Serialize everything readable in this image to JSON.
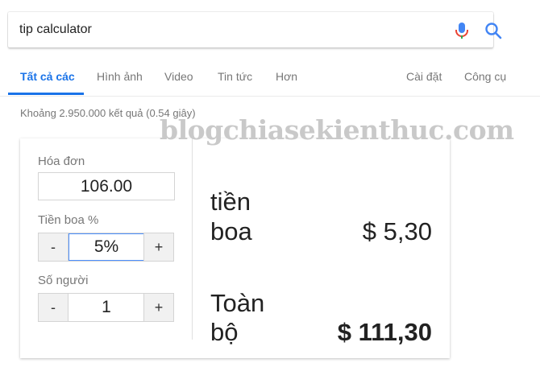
{
  "search": {
    "query": "tip calculator"
  },
  "tabs": [
    {
      "label": "Tất cả các",
      "active": true
    },
    {
      "label": "Hình ảnh"
    },
    {
      "label": "Video"
    },
    {
      "label": "Tin tức"
    },
    {
      "label": "Hơn"
    },
    {
      "label": "Cài đặt"
    },
    {
      "label": "Công cụ"
    }
  ],
  "result_stats": "Khoảng 2.950.000 kết quả (0.54 giây)",
  "watermark": "blogchiasekienthuc.com",
  "calculator": {
    "bill_label": "Hóa đơn",
    "bill_value": "106.00",
    "tip_label": "Tiền boa %",
    "tip_value": "5%",
    "people_label": "Số người",
    "people_value": "1",
    "minus": "-",
    "plus": "+",
    "tip_out_label_1": "tiền",
    "tip_out_label_2": "boa",
    "tip_out_value": "$ 5,30",
    "total_label_1": "Toàn",
    "total_label_2": "bộ",
    "total_value": "$ 111,30"
  },
  "colors": {
    "accent": "#1a73e8",
    "mic_red": "#ea4335",
    "mic_blue": "#4285f4"
  },
  "icons": {
    "mic": "mic-icon",
    "search": "search-icon"
  }
}
